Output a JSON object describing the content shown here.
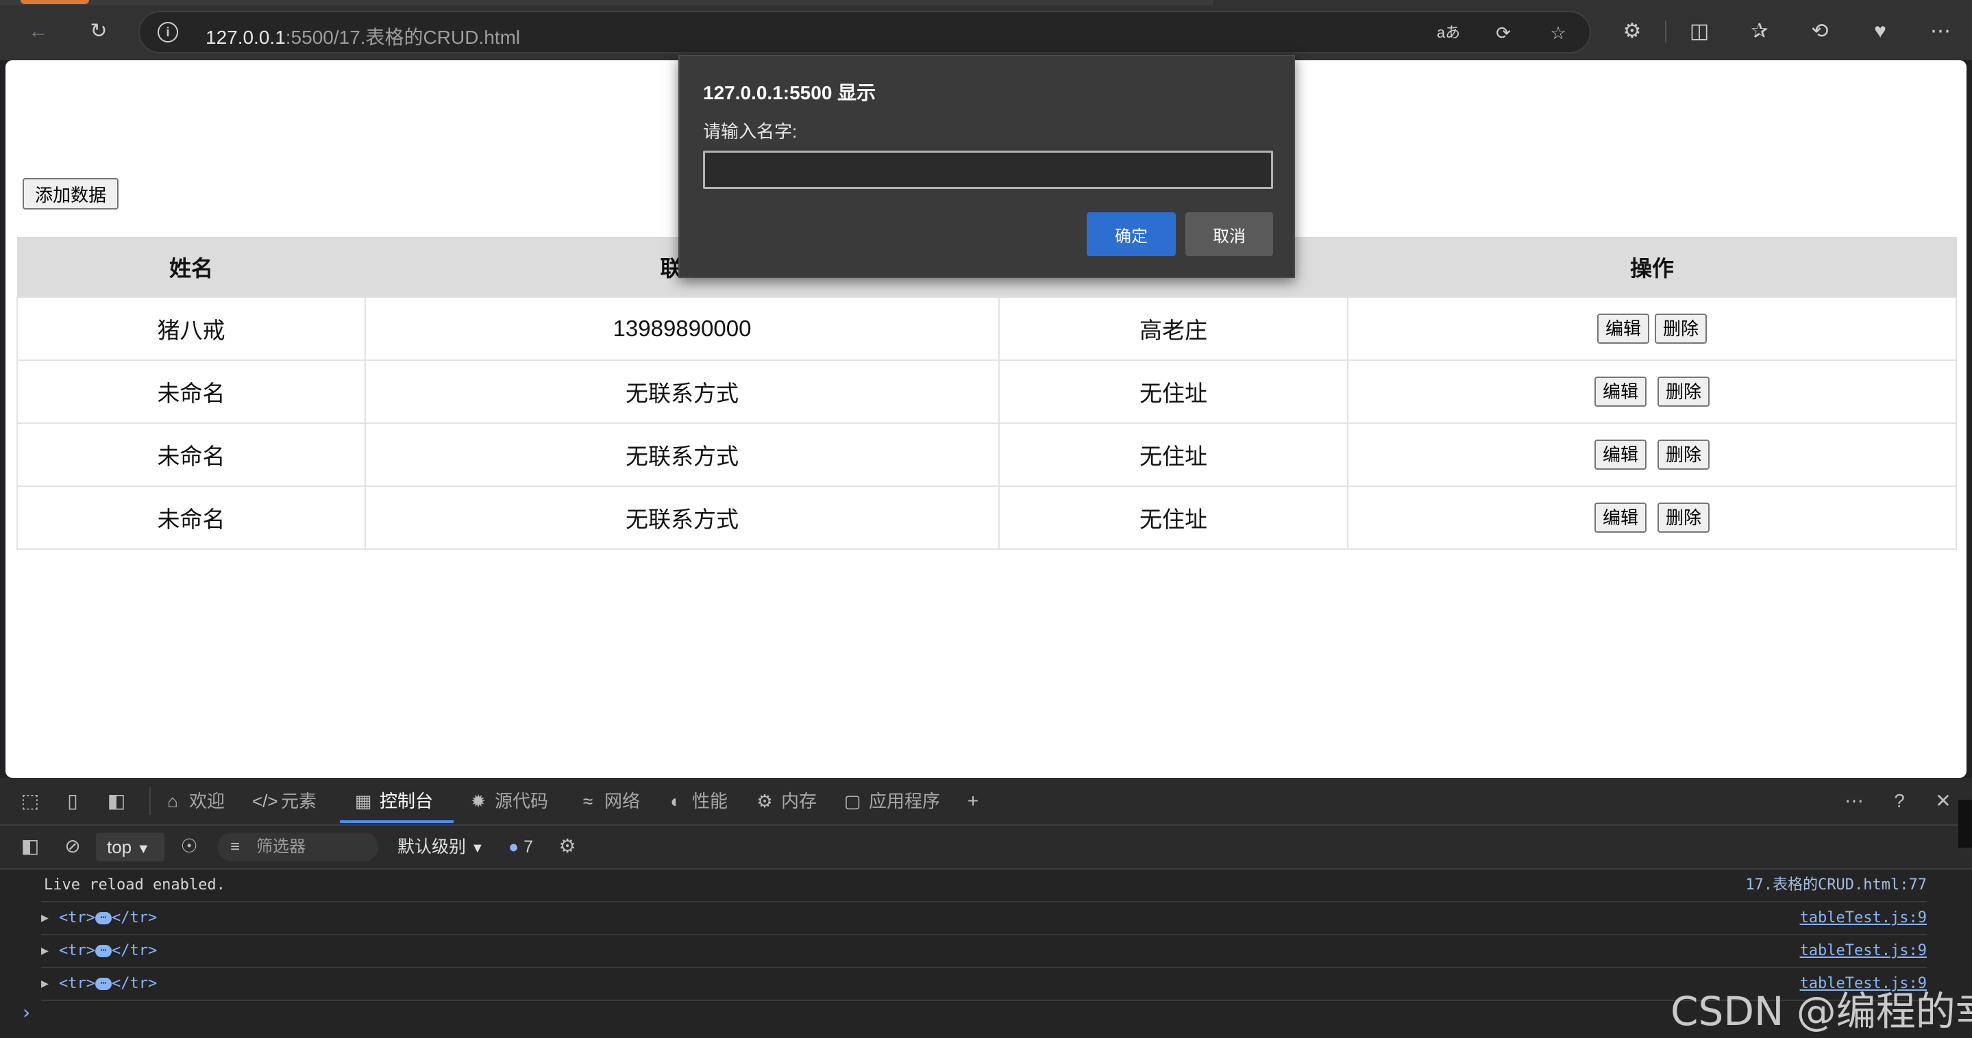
{
  "browser": {
    "url_host": "127.0.0.1",
    "url_rest": ":5500/17.表格的CRUD.html"
  },
  "page": {
    "add_button": "添加数据",
    "table": {
      "headers": [
        "姓名",
        "联系",
        "",
        "操作"
      ],
      "rows": [
        {
          "name": "猪八戒",
          "contact": "13989890000",
          "address": "高老庄"
        },
        {
          "name": "未命名",
          "contact": "无联系方式",
          "address": "无住址"
        },
        {
          "name": "未命名",
          "contact": "无联系方式",
          "address": "无住址"
        },
        {
          "name": "未命名",
          "contact": "无联系方式",
          "address": "无住址"
        }
      ],
      "edit_label": "编辑",
      "delete_label": "删除"
    }
  },
  "dialog": {
    "title": "127.0.0.1:5500 显示",
    "message": "请输入名字:",
    "input_value": "",
    "ok_label": "确定",
    "cancel_label": "取消"
  },
  "devtools": {
    "tabs": [
      {
        "label": "欢迎",
        "icon": "home-icon"
      },
      {
        "label": "元素",
        "icon": "code-icon"
      },
      {
        "label": "控制台",
        "icon": "console-icon"
      },
      {
        "label": "源代码",
        "icon": "bug-icon"
      },
      {
        "label": "网络",
        "icon": "wifi-icon"
      },
      {
        "label": "性能",
        "icon": "gauge-icon"
      },
      {
        "label": "内存",
        "icon": "chip-icon"
      },
      {
        "label": "应用程序",
        "icon": "app-icon"
      }
    ],
    "active_tab": "控制台",
    "context": "top",
    "filter_placeholder": "筛选器",
    "level": "默认级别",
    "message_count": "7",
    "console": [
      {
        "text": "Live reload enabled.",
        "source": "17.表格的CRUD.html:77"
      },
      {
        "text": "<tr>",
        "text_end": "</tr>",
        "source": "tableTest.js:9"
      },
      {
        "text": "<tr>",
        "text_end": "</tr>",
        "source": "tableTest.js:9"
      },
      {
        "text": "<tr>",
        "text_end": "</tr>",
        "source": "tableTest.js:9"
      }
    ]
  },
  "watermark": "CSDN @编程的幸"
}
